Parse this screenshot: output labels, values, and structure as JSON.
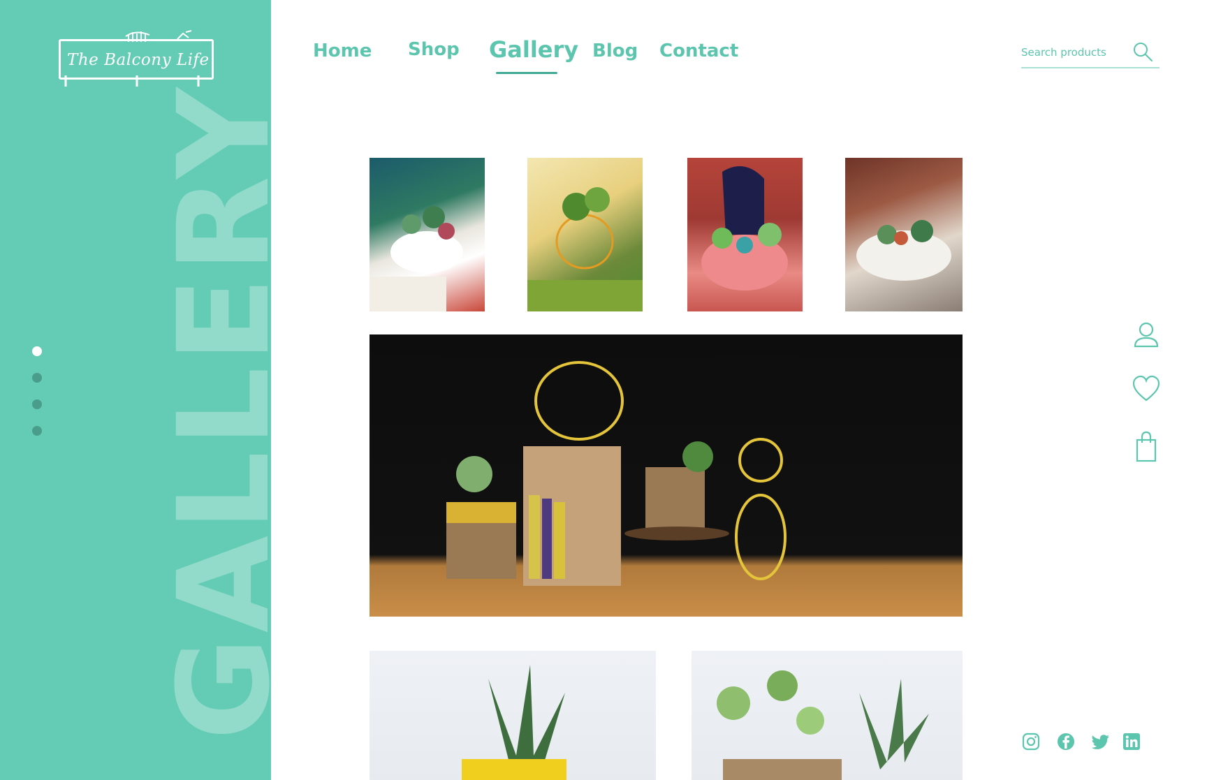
{
  "brand": {
    "logo_text": "The Balcony Life"
  },
  "sidebar": {
    "section_word": "GALLERY",
    "dots": [
      {
        "active": true
      },
      {
        "active": false
      },
      {
        "active": false
      },
      {
        "active": false
      }
    ]
  },
  "nav": {
    "home": "Home",
    "shop": "Shop",
    "gallery": "Gallery",
    "blog": "Blog",
    "contact": "Contact",
    "active": "gallery"
  },
  "search": {
    "placeholder": "Search products",
    "value": ""
  },
  "icons": {
    "search": "search-icon",
    "user": "user-icon",
    "wishlist": "heart-icon",
    "cart": "shopping-bag-icon",
    "social": [
      "instagram-icon",
      "facebook-icon",
      "twitter-icon",
      "linkedin-icon"
    ]
  },
  "colors": {
    "sidebar_bg": "#64ccb4",
    "accent": "#5cc5ad",
    "accent_dark": "#3fa996",
    "dot_inactive": "#4a9d8b"
  }
}
